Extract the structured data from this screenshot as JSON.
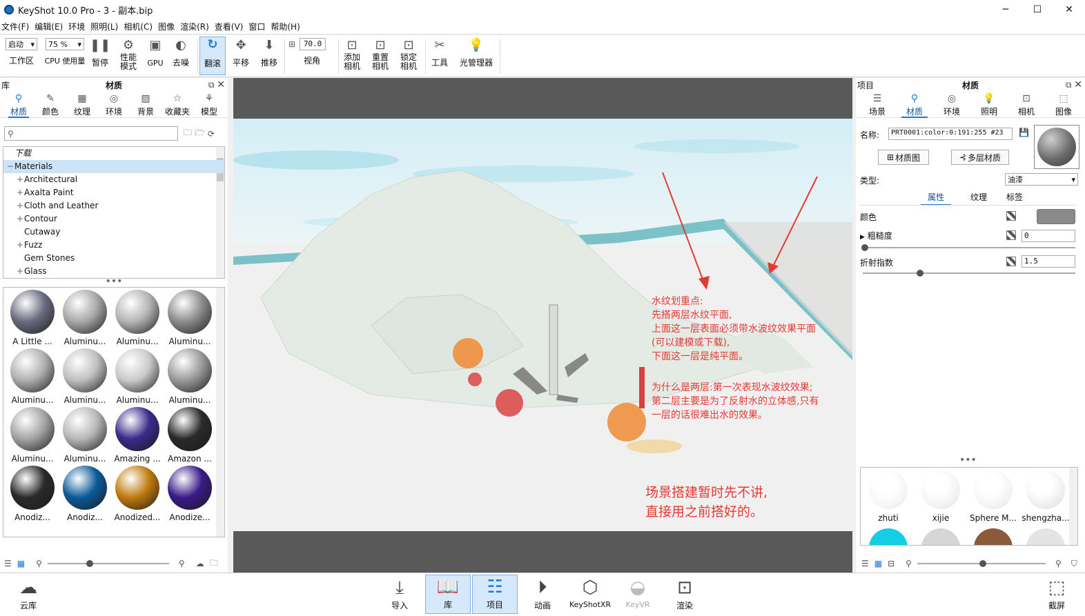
{
  "window": {
    "title": "KeyShot 10.0 Pro  - 3 - 副本.bip"
  },
  "menu": [
    "文件(F)",
    "编辑(E)",
    "环境",
    "照明(L)",
    "相机(C)",
    "图像",
    "渲染(R)",
    "查看(V)",
    "窗口",
    "帮助(H)"
  ],
  "toolbar": {
    "workspace_select": "启动",
    "workspace_label": "工作区",
    "cpu_select": "75 %",
    "cpu_label": "CPU 使用量",
    "pause": "暂停",
    "perf_mode": "性能\n模式",
    "gpu": "GPU",
    "denoise": "去噪",
    "tumble": "翻滚",
    "pan": "平移",
    "dolly": "推移",
    "fov_value": "70.0",
    "fov_label": "视角",
    "add_camera": "添加\n相机",
    "reset_camera": "重置\n相机",
    "lock_camera": "锁定\n相机",
    "tools": "工具",
    "light_manager": "光管理器"
  },
  "library": {
    "header_left": "库",
    "header_title": "材质",
    "tabs": [
      "材质",
      "颜色",
      "纹理",
      "环境",
      "背景",
      "收藏夹",
      "模型"
    ],
    "search_placeholder": "",
    "tree": [
      {
        "label": "下载",
        "level": 0,
        "expander": ""
      },
      {
        "label": "Materials",
        "level": 0,
        "expander": "−"
      },
      {
        "label": "Architectural",
        "level": 1,
        "expander": "+"
      },
      {
        "label": "Axalta Paint",
        "level": 1,
        "expander": "+"
      },
      {
        "label": "Cloth and Leather",
        "level": 1,
        "expander": "+"
      },
      {
        "label": "Contour",
        "level": 1,
        "expander": "+"
      },
      {
        "label": "Cutaway",
        "level": 1,
        "expander": ""
      },
      {
        "label": "Fuzz",
        "level": 1,
        "expander": "+"
      },
      {
        "label": "Gem Stones",
        "level": 1,
        "expander": ""
      },
      {
        "label": "Glass",
        "level": 1,
        "expander": "+"
      }
    ],
    "thumbnails": [
      {
        "label": "A Little ...",
        "color": "#6a6a80"
      },
      {
        "label": "Aluminu...",
        "color": "#a8a8a8"
      },
      {
        "label": "Aluminu...",
        "color": "#b4b4b4"
      },
      {
        "label": "Aluminu...",
        "color": "#8c8c8c"
      },
      {
        "label": "Aluminu...",
        "color": "#b0b0b0"
      },
      {
        "label": "Aluminu...",
        "color": "#c0c0c0"
      },
      {
        "label": "Aluminu...",
        "color": "#cacaca"
      },
      {
        "label": "Aluminu...",
        "color": "#9a9a9a"
      },
      {
        "label": "Aluminu...",
        "color": "#a4a4a4"
      },
      {
        "label": "Aluminu...",
        "color": "#b8b8b8"
      },
      {
        "label": "Amazing ...",
        "color": "#3a2a8a"
      },
      {
        "label": "Amazon ...",
        "color": "#2a2a2a"
      },
      {
        "label": "Anodiz...",
        "color": "#2a2a2a"
      },
      {
        "label": "Anodiz...",
        "color": "#0a5a9a"
      },
      {
        "label": "Anodized...",
        "color": "#c07a10"
      },
      {
        "label": "Anodize...",
        "color": "#3a1a8a"
      }
    ]
  },
  "project": {
    "header_left": "项目",
    "header_title": "材质",
    "tabs": [
      "场景",
      "材质",
      "环境",
      "照明",
      "相机",
      "图像"
    ],
    "name_label": "名称:",
    "name_value": "PRT0001:color:0:191:255 #23",
    "material_graph": "材质图",
    "multilayer": "多层材质",
    "type_label": "类型:",
    "type_value": "油漆",
    "subtabs": [
      "属性",
      "纹理",
      "标签"
    ],
    "color_label": "颜色",
    "color_value": "#8a8a8a",
    "roughness_label": "粗糙度",
    "roughness_value": "0",
    "ior_label": "折射指数",
    "ior_value": "1.5",
    "scene_materials": [
      {
        "label": "zhuti",
        "color": "#f4f4f4"
      },
      {
        "label": "xijie",
        "color": "#f0f0f0"
      },
      {
        "label": "Sphere M...",
        "color": "#f2f2f2"
      },
      {
        "label": "shengzha...",
        "color": "#ececec"
      }
    ]
  },
  "annotations": {
    "block1": [
      "水纹划重点:",
      "先搭两层水纹平面,",
      "上面这一层表面必须带水波纹效果平面",
      "(可以建模或下载),",
      "下面这一层是纯平面。"
    ],
    "block2": [
      "为什么是两层:第一次表现水波纹效果;",
      "第二层主要是为了反射水的立体感,只有",
      "一层的话很难出水的效果。"
    ],
    "block3": [
      "场景搭建暂时先不讲,",
      "直接用之前搭好的。"
    ]
  },
  "bottombar": {
    "cloud": "云库",
    "import": "导入",
    "library": "库",
    "project": "项目",
    "animation": "动画",
    "keyshotxr": "KeyShotXR",
    "keyvr": "KeyVR",
    "render": "渲染",
    "screenshot": "截屏"
  }
}
